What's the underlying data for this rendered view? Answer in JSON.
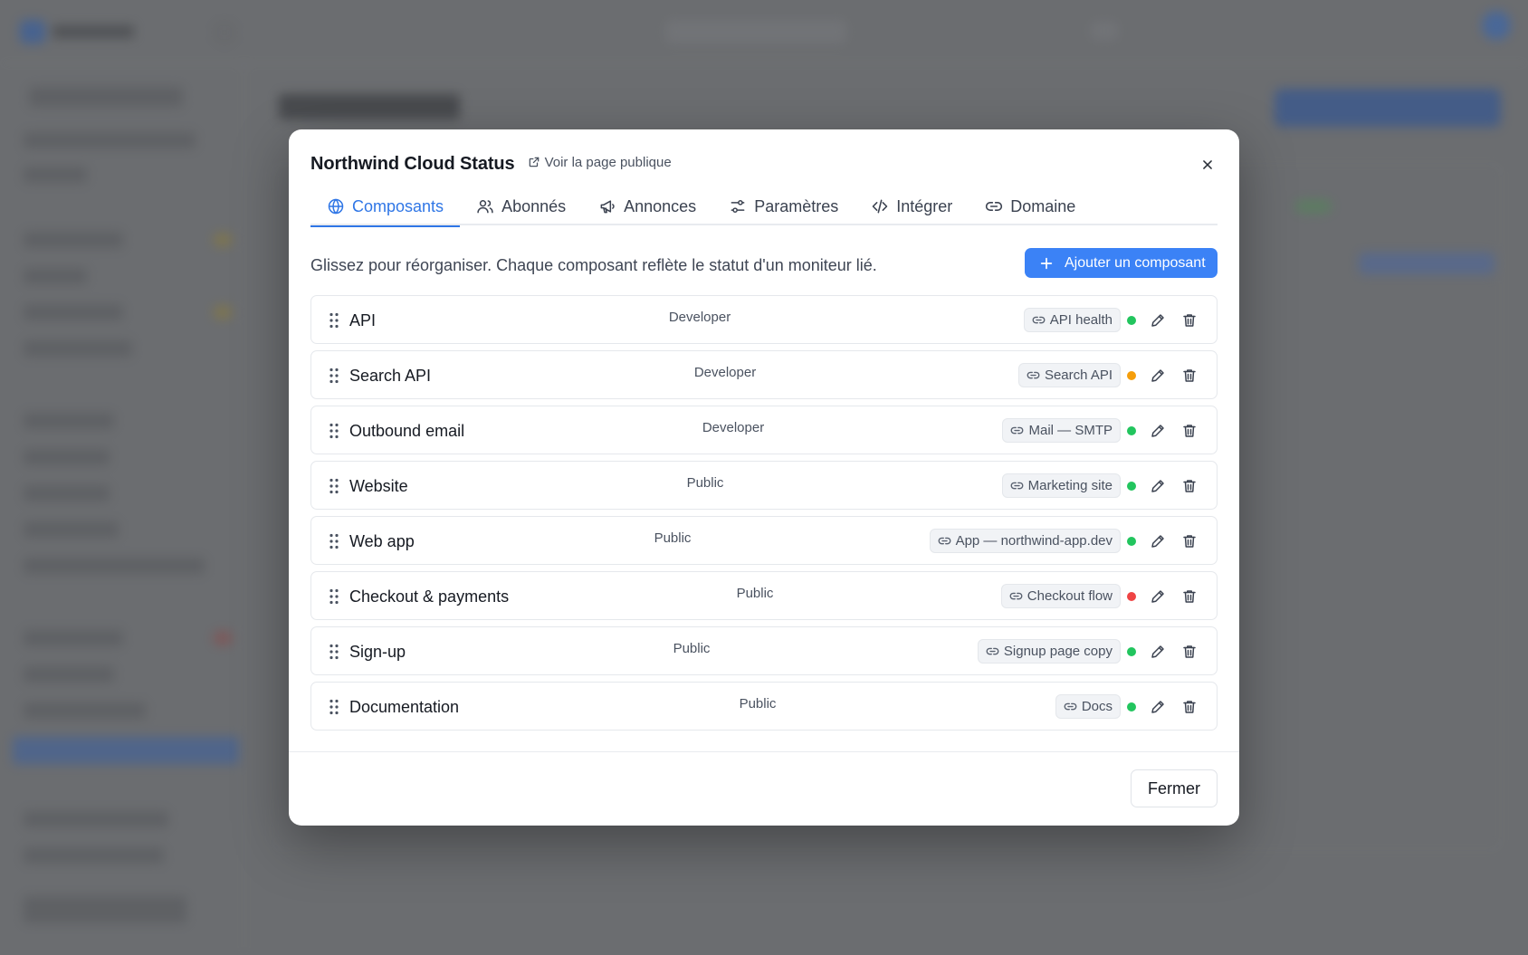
{
  "modal": {
    "title": "Northwind Cloud Status",
    "public_link": "Voir la page publique",
    "tabs": [
      {
        "label": "Composants",
        "icon": "globe-icon",
        "active": true
      },
      {
        "label": "Abonnés",
        "icon": "users-icon",
        "active": false
      },
      {
        "label": "Annonces",
        "icon": "megaphone-icon",
        "active": false
      },
      {
        "label": "Paramètres",
        "icon": "sliders-icon",
        "active": false
      },
      {
        "label": "Intégrer",
        "icon": "code-icon",
        "active": false
      },
      {
        "label": "Domaine",
        "icon": "link-icon",
        "active": false
      }
    ],
    "intro": "Glissez pour réorganiser. Chaque composant reflète le statut d'un moniteur lié.",
    "add_button": "Ajouter un composant",
    "components": [
      {
        "name": "API",
        "group": "Developer",
        "monitor": "API health",
        "status_color": "#22c55e"
      },
      {
        "name": "Search API",
        "group": "Developer",
        "monitor": "Search API",
        "status_color": "#f59e0b"
      },
      {
        "name": "Outbound email",
        "group": "Developer",
        "monitor": "Mail — SMTP",
        "status_color": "#22c55e"
      },
      {
        "name": "Website",
        "group": "Public",
        "monitor": "Marketing site",
        "status_color": "#22c55e"
      },
      {
        "name": "Web app",
        "group": "Public",
        "monitor": "App — northwind-app.dev",
        "status_color": "#22c55e"
      },
      {
        "name": "Checkout & payments",
        "group": "Public",
        "monitor": "Checkout flow",
        "status_color": "#ef4444"
      },
      {
        "name": "Sign-up",
        "group": "Public",
        "monitor": "Signup page copy",
        "status_color": "#22c55e"
      },
      {
        "name": "Documentation",
        "group": "Public",
        "monitor": "Docs",
        "status_color": "#22c55e"
      }
    ],
    "close_button": "Fermer"
  },
  "colors": {
    "accent": "#3b82f6",
    "status_ok": "#22c55e",
    "status_warn": "#f59e0b",
    "status_down": "#ef4444"
  }
}
